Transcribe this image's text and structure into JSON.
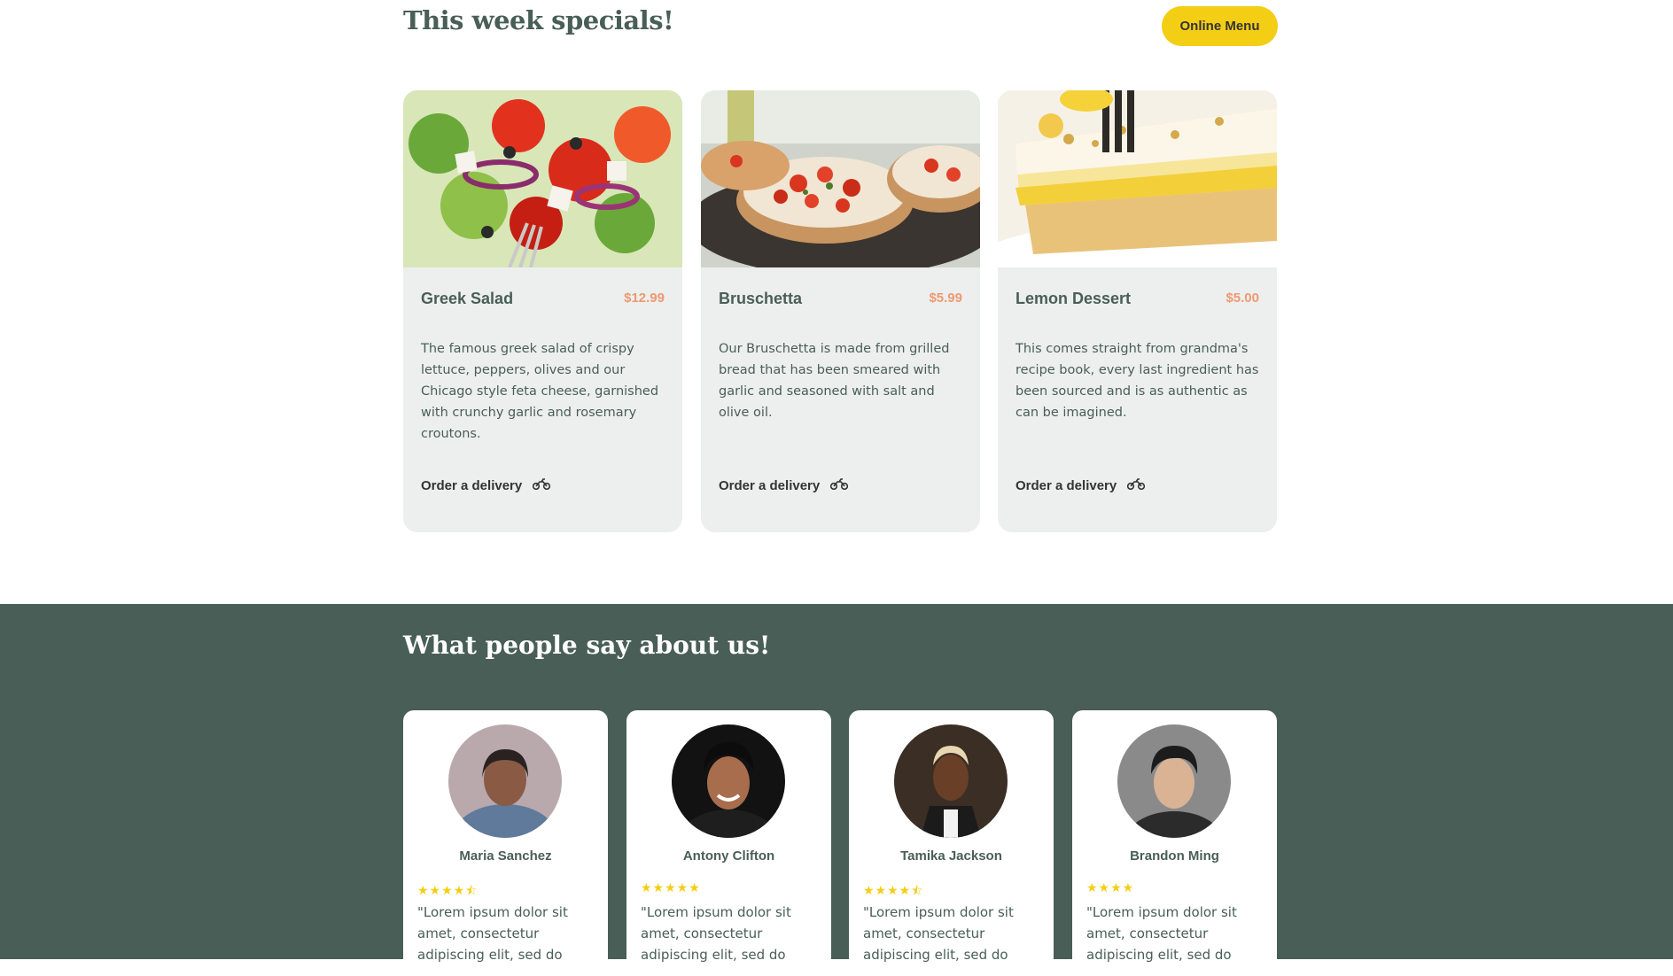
{
  "specials": {
    "title": "This week specials!",
    "online_menu_label": "Online Menu",
    "items": [
      {
        "name": "Greek Salad",
        "price": "$12.99",
        "description": "The famous greek salad of crispy lettuce, peppers, olives and our Chicago style feta cheese, garnished with crunchy garlic and rosemary croutons.",
        "order_label": "Order a delivery"
      },
      {
        "name": "Bruschetta",
        "price": "$5.99",
        "description": "Our Bruschetta is made from grilled bread that has been smeared with garlic and seasoned with salt and olive oil.",
        "order_label": "Order a delivery"
      },
      {
        "name": "Lemon Dessert",
        "price": "$5.00",
        "description": "This comes straight from grandma's recipe book, every last ingredient has been sourced and is as authentic as can be imagined.",
        "order_label": "Order a delivery"
      }
    ]
  },
  "testimonials": {
    "title": "What people say about us!",
    "reviews": [
      {
        "name": "Maria Sanchez",
        "rating": 4.5,
        "stars": "★★★★⯪",
        "quote": "\"Lorem ipsum dolor sit amet, consectetur adipiscing elit, sed do"
      },
      {
        "name": "Antony Clifton",
        "rating": 5,
        "stars": "★★★★★",
        "quote": "\"Lorem ipsum dolor sit amet, consectetur adipiscing elit, sed do"
      },
      {
        "name": "Tamika Jackson",
        "rating": 4.5,
        "stars": "★★★★⯪",
        "quote": "\"Lorem ipsum dolor sit amet, consectetur adipiscing elit, sed do"
      },
      {
        "name": "Brandon Ming",
        "rating": 4,
        "stars": "★★★★",
        "quote": "\"Lorem ipsum dolor sit amet, consectetur adipiscing elit, sed do"
      }
    ]
  },
  "colors": {
    "primary_green": "#495e57",
    "primary_yellow": "#f4ce14",
    "card_bg": "#edefee",
    "price_salmon": "#ee9972"
  },
  "icons": {
    "delivery": "motorcycle-icon",
    "star": "star-icon"
  }
}
